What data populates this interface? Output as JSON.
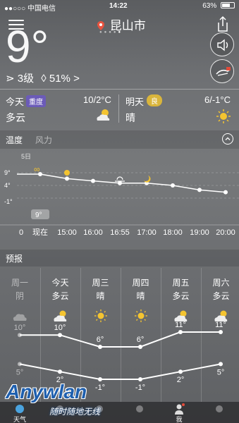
{
  "status": {
    "carrier": "●●○○○ 中国电信",
    "time": "14:22",
    "battery": "63%",
    "battery_level": 0.63
  },
  "header": {
    "city": "昆山市"
  },
  "current": {
    "temperature": "9°",
    "wind": "3级",
    "humidity": "51%"
  },
  "today": {
    "label": "今天",
    "aqi_badge": "重度",
    "temp_range": "10/2°C",
    "condition": "多云"
  },
  "tomorrow": {
    "label": "明天",
    "aqi_badge": "良",
    "temp_range": "6/-1°C",
    "condition": "晴"
  },
  "hourly_tabs": {
    "temperature": "温度",
    "wind": "风力"
  },
  "hourly_chart": {
    "type": "line",
    "date_label": "5日",
    "y_ticks": [
      "9°",
      "4°",
      "-1°"
    ],
    "x_labels": [
      "0",
      "现在",
      "15:00",
      "16:00",
      "16:55",
      "17:00",
      "18:00",
      "19:00",
      "20:00"
    ],
    "current_tooltip": "9°",
    "points": [
      {
        "x": "现在",
        "y": 9
      },
      {
        "x": "15:00",
        "y": 7
      },
      {
        "x": "16:00",
        "y": 6
      },
      {
        "x": "16:55",
        "y": 5
      },
      {
        "x": "17:00",
        "y": 5
      },
      {
        "x": "18:00",
        "y": 4
      },
      {
        "x": "19:00",
        "y": 2
      },
      {
        "x": "20:00",
        "y": 1
      }
    ]
  },
  "forecast_section": {
    "title": "预报"
  },
  "forecast": {
    "days": [
      {
        "day": "周一",
        "cond": "阴",
        "high": 10,
        "low": 5,
        "icon": "cloud-icon"
      },
      {
        "day": "今天",
        "cond": "多云",
        "high": 10,
        "low": 2,
        "icon": "partly-cloudy-icon"
      },
      {
        "day": "周三",
        "cond": "晴",
        "high": 6,
        "low": -1,
        "icon": "sun-icon"
      },
      {
        "day": "周四",
        "cond": "晴",
        "high": 6,
        "low": -1,
        "icon": "sun-icon"
      },
      {
        "day": "周五",
        "cond": "多云",
        "high": 11,
        "low": 2,
        "icon": "partly-cloudy-icon"
      },
      {
        "day": "周六",
        "cond": "多云",
        "high": 11,
        "low": 5,
        "icon": "partly-cloudy-icon"
      }
    ],
    "high_labels": [
      "10°",
      "10°",
      "6°",
      "6°",
      "11°",
      "11°"
    ],
    "low_labels": [
      "5°",
      "2°",
      "-1°",
      "-1°",
      "2°",
      "5°"
    ]
  },
  "tabbar": {
    "items": [
      "天气",
      "",
      "",
      "",
      "我",
      ""
    ]
  },
  "watermark": {
    "brand": "Anywlan",
    "slogan": "随时随地无线"
  }
}
